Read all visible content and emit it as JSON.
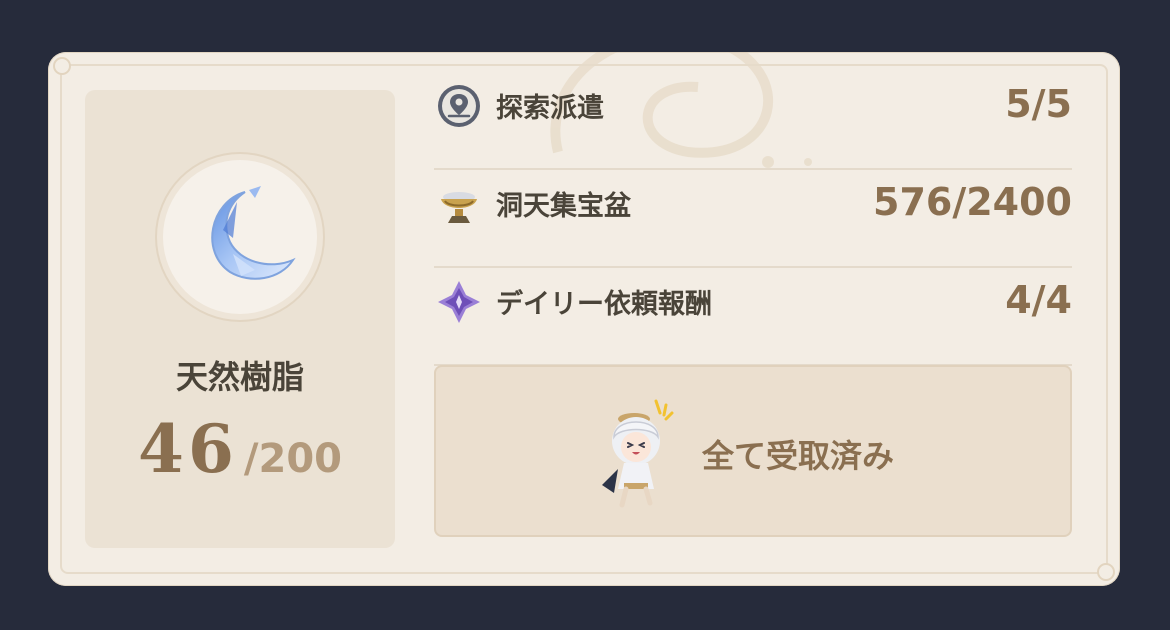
{
  "resin": {
    "icon": "fragile-resin-crescent-icon",
    "name": "天然樹脂",
    "current": "46",
    "max": "/200"
  },
  "rows": [
    {
      "icon": "expedition-map-pin-icon",
      "label": "探索派遣",
      "value": "5/5"
    },
    {
      "icon": "serenitea-treasure-bowl-icon",
      "label": "洞天集宝盆",
      "value": "576/2400"
    },
    {
      "icon": "daily-commission-star-icon",
      "label": "デイリー依頼報酬",
      "value": "4/4"
    }
  ],
  "claim": {
    "icon": "paimon-mascot-icon",
    "label": "全て受取済み"
  },
  "colors": {
    "background": "#262b3b",
    "card": "#f3ede4",
    "panel": "#ebe2d4",
    "accent_brown": "#8a6f50",
    "text_dark": "#4a4439"
  }
}
